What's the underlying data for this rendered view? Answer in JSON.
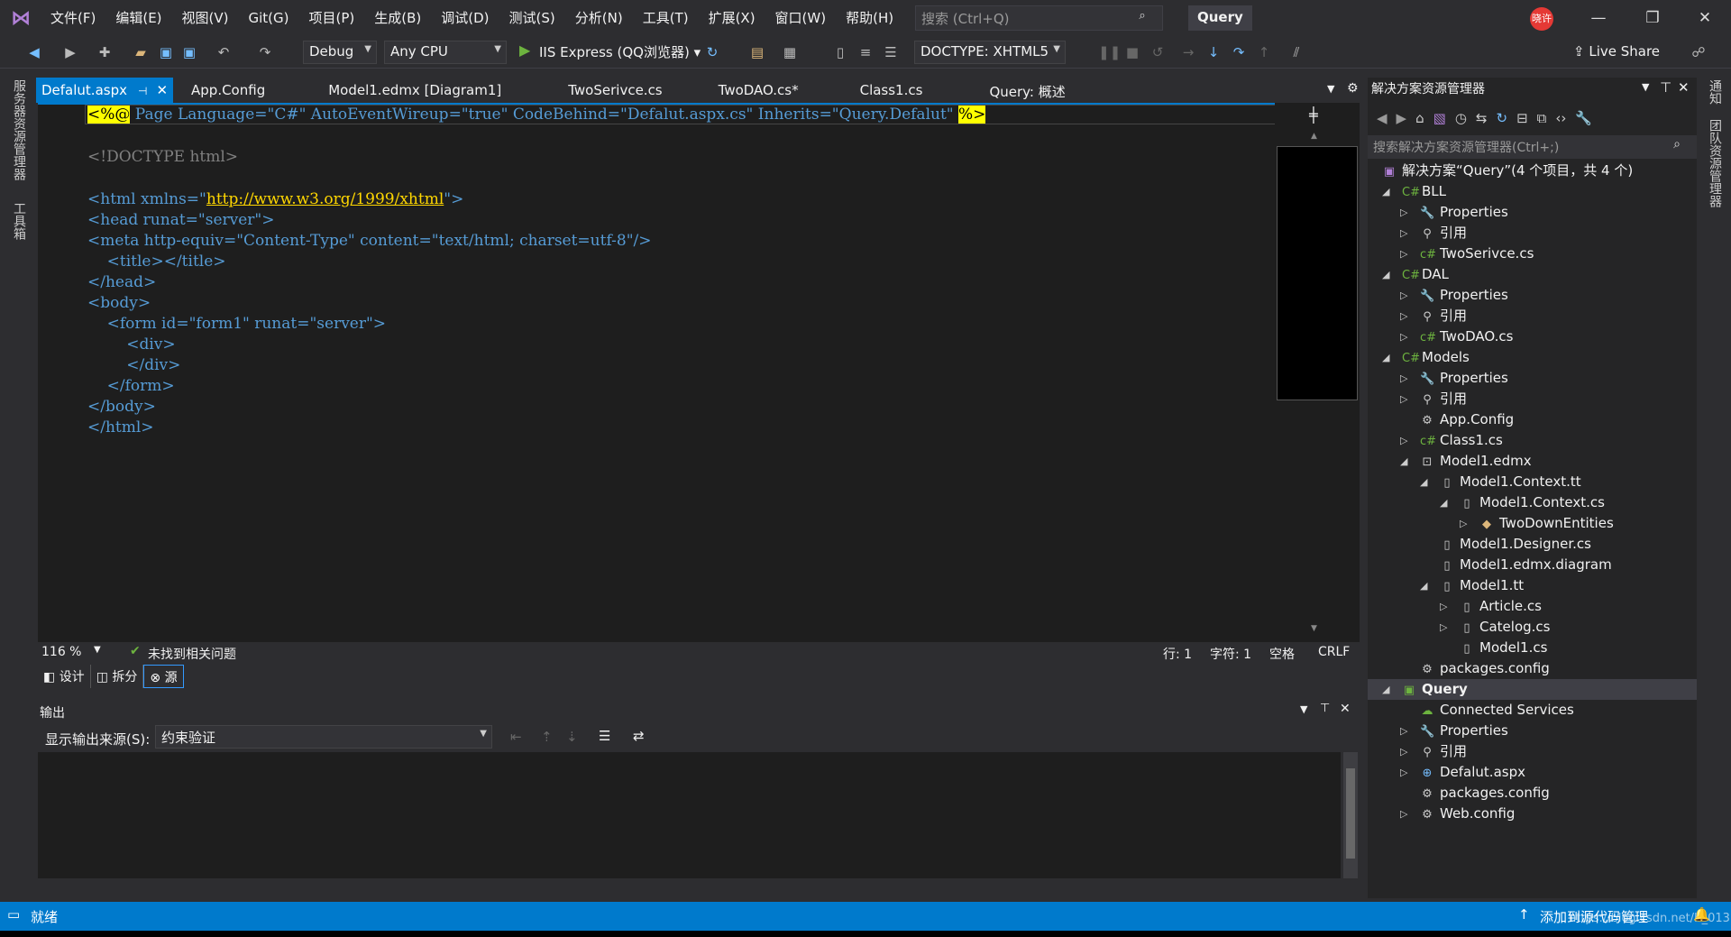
{
  "window": {
    "menu": [
      "文件(F)",
      "编辑(E)",
      "视图(V)",
      "Git(G)",
      "项目(P)",
      "生成(B)",
      "调试(D)",
      "测试(S)",
      "分析(N)",
      "工具(T)",
      "扩展(X)",
      "窗口(W)",
      "帮助(H)"
    ],
    "search_placeholder": "搜索 (Ctrl+Q)",
    "title": "Query",
    "avatar_text": "晓许"
  },
  "toolbar": {
    "config": "Debug",
    "platform": "Any CPU",
    "run_target": "IIS Express (QQ浏览器)",
    "doctype": "DOCTYPE: XHTML5",
    "live_share": "Live Share"
  },
  "left_strip": [
    "服务器资源管理器",
    "工具箱"
  ],
  "right_strip": [
    "通知",
    "团队资源管理器"
  ],
  "tabs": [
    "Defalut.aspx",
    "App.Config",
    "Model1.edmx [Diagram1]",
    "TwoSerivce.cs",
    "TwoDAO.cs*",
    "Class1.cs",
    "Query: 概述"
  ],
  "code": {
    "l1_open": "<%@",
    "l1_mid": " Page Language=\"C#\" AutoEventWireup=\"true\" CodeBehind=\"Defalut.aspx.cs\" Inherits=\"Query.Defalut\" ",
    "l1_close": "%>",
    "l2": "<!DOCTYPE html>",
    "l3_a": "<html xmlns=\"",
    "l3_url": "http://www.w3.org/1999/xhtml",
    "l3_b": "\">",
    "l4": "<head runat=\"server\">",
    "l5": "<meta http-equiv=\"Content-Type\" content=\"text/html; charset=utf-8\"/>",
    "l6": "    <title></title>",
    "l7": "</head>",
    "l8": "<body>",
    "l9": "    <form id=\"form1\" runat=\"server\">",
    "l10": "        <div>",
    "l11": "        </div>",
    "l12": "    </form>",
    "l13": "</body>",
    "l14": "</html>"
  },
  "editor_status": {
    "zoom": "116 %",
    "issues": "未找到相关问题",
    "line": "行: 1",
    "char": "字符: 1",
    "space": "空格",
    "eol": "CRLF"
  },
  "view_tabs": [
    "设计",
    "拆分",
    "源"
  ],
  "output": {
    "title": "输出",
    "source_label": "显示输出来源(S):",
    "source_value": "约束验证"
  },
  "solution": {
    "title": "解决方案资源管理器",
    "search": "搜索解决方案资源管理器(Ctrl+;)",
    "root": "解决方案“Query”(4 个项目，共 4 个)",
    "items": [
      "BLL",
      "Properties",
      "引用",
      "TwoSerivce.cs",
      "DAL",
      "Properties",
      "引用",
      "TwoDAO.cs",
      "Models",
      "Properties",
      "引用",
      "App.Config",
      "Class1.cs",
      "Model1.edmx",
      "Model1.Context.tt",
      "Model1.Context.cs",
      "TwoDownEntities",
      "Model1.Designer.cs",
      "Model1.edmx.diagram",
      "Model1.tt",
      "Article.cs",
      "Catelog.cs",
      "Model1.cs",
      "packages.config",
      "Query",
      "Connected Services",
      "Properties",
      "引用",
      "Defalut.aspx",
      "packages.config",
      "Web.config"
    ]
  },
  "status": {
    "ready": "就绪",
    "source_control": "添加到源代码管理",
    "watermark": "https://blog.csdn.net/K_013"
  }
}
